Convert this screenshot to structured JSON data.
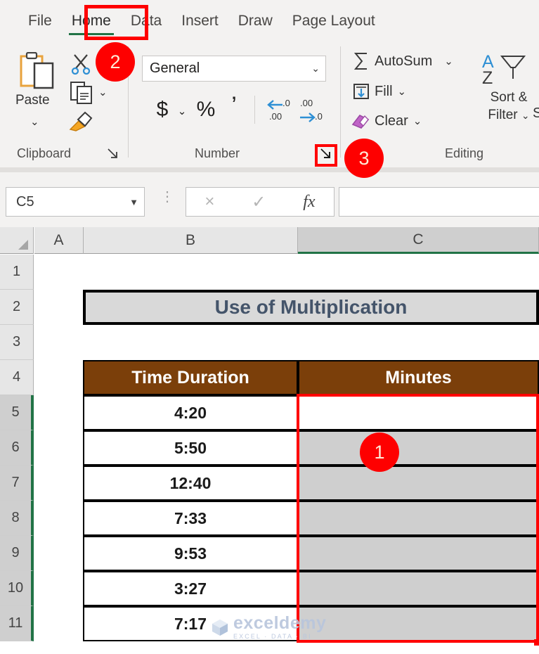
{
  "ribbon": {
    "tabs": [
      {
        "label": "File",
        "active": false
      },
      {
        "label": "Home",
        "active": true
      },
      {
        "label": "Data",
        "active": false
      },
      {
        "label": "Insert",
        "active": false
      },
      {
        "label": "Draw",
        "active": false
      },
      {
        "label": "Page Layout",
        "active": false
      }
    ],
    "groups": {
      "clipboard": {
        "label": "Clipboard",
        "paste_label": "Paste",
        "paste_chevron": "⌄",
        "copy_chevron": "⌄",
        "icons": [
          "paste-icon",
          "cut-scissors-icon",
          "copy-icon",
          "format-painter-icon"
        ],
        "launcher": "dialog-launcher-icon"
      },
      "number": {
        "label": "Number",
        "format_value": "General",
        "format_chevron": "⌄",
        "currency_label": "$",
        "currency_chevron": "⌄",
        "percent_label": "%",
        "comma_label": "’",
        "increase_decimal": "increase-decimal-icon",
        "decrease_decimal": "decrease-decimal-icon",
        "launcher": "dialog-launcher-icon"
      },
      "editing": {
        "label": "Editing",
        "autosum_label": "AutoSum",
        "autosum_chevron": "⌄",
        "fill_label": "Fill",
        "fill_chevron": "⌄",
        "clear_label": "Clear",
        "clear_chevron": "⌄",
        "sortfilter_line1": "Sort &",
        "sortfilter_line2": "Filter",
        "sortfilter_chevron": "⌄",
        "find_select_partial": "S"
      }
    }
  },
  "formula_bar": {
    "name_box_value": "C5",
    "name_box_chevron": "▼",
    "cancel_icon": "×",
    "enter_icon": "✓",
    "function_icon": "fx",
    "formula_value": ""
  },
  "sheet": {
    "columns": [
      {
        "label": "A",
        "selected": false
      },
      {
        "label": "B",
        "selected": false
      },
      {
        "label": "C",
        "selected": true
      }
    ],
    "rows": [
      {
        "label": "1",
        "selected": false
      },
      {
        "label": "2",
        "selected": false
      },
      {
        "label": "3",
        "selected": false
      },
      {
        "label": "4",
        "selected": false
      },
      {
        "label": "5",
        "selected": true
      },
      {
        "label": "6",
        "selected": true
      },
      {
        "label": "7",
        "selected": true
      },
      {
        "label": "8",
        "selected": true
      },
      {
        "label": "9",
        "selected": true
      },
      {
        "label": "10",
        "selected": true
      },
      {
        "label": "11",
        "selected": true
      }
    ],
    "title": "Use of Multiplication",
    "table_headers": [
      "Time Duration",
      "Minutes"
    ],
    "table_rows": [
      {
        "time_duration": "4:20",
        "minutes": ""
      },
      {
        "time_duration": "5:50",
        "minutes": ""
      },
      {
        "time_duration": "12:40",
        "minutes": ""
      },
      {
        "time_duration": "7:33",
        "minutes": ""
      },
      {
        "time_duration": "9:53",
        "minutes": ""
      },
      {
        "time_duration": "3:27",
        "minutes": ""
      },
      {
        "time_duration": "7:17",
        "minutes": ""
      }
    ]
  },
  "callouts": [
    {
      "number": "1"
    },
    {
      "number": "2"
    },
    {
      "number": "3"
    }
  ],
  "watermark": {
    "name": "exceldemy",
    "tagline": "EXCEL · DATA · BI"
  },
  "colors": {
    "annotation_red": "#ff0000",
    "header_brown": "#7b3f0a",
    "title_gray": "#d9d9d9",
    "title_text": "#44546a",
    "excel_green": "#217346",
    "selection_gray": "#cfcfcf"
  }
}
